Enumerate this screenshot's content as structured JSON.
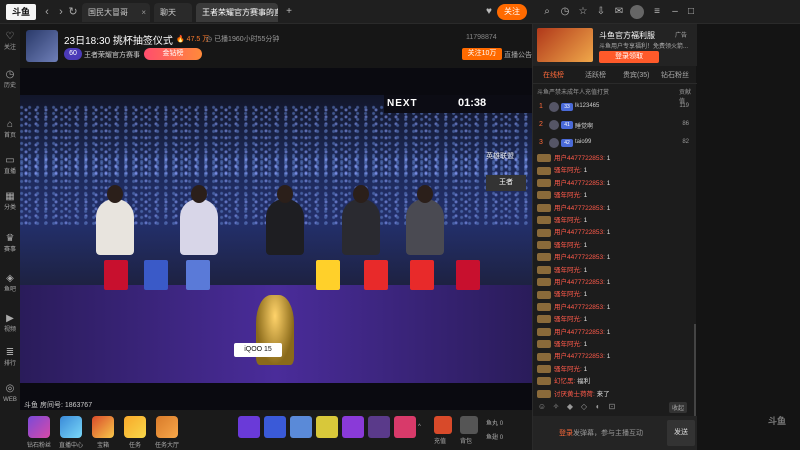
{
  "browser": {
    "logo": "斗鱼",
    "tabs": [
      {
        "label": "国民大冒哥"
      },
      {
        "label": "聊天"
      },
      {
        "label": "王者荣耀官方赛事的直播间 @..."
      }
    ],
    "follow_label": "关注"
  },
  "sidebar": {
    "items": [
      "关注",
      "历史",
      "首页",
      "直播",
      "分类",
      "赛事",
      "鱼吧",
      "视频",
      "排行",
      "WEB"
    ]
  },
  "room": {
    "title": "23日18:30 挑杯抽签仪式",
    "hot": "47.5 万",
    "live_time": "已播1960小时55分钟",
    "anchor": "王者荣耀官方赛事",
    "fan_badge": "金钻榜",
    "level": "60",
    "room_id_top": "11798874",
    "follow_count": "关注10万",
    "notice_label": "直播公告",
    "room_num_label": "斗鱼 房间号: 1863767"
  },
  "video": {
    "next_label": "NEXT",
    "timer": "01:38",
    "banner": "王者",
    "cam_logo": "英雄联盟",
    "sponsor": "iQOO 15"
  },
  "giftbar": {
    "labels": [
      "钻石粉丝",
      "直播中心",
      "宝箱",
      "任务",
      "任务大厅"
    ],
    "right_labels": [
      "充值",
      "背包"
    ],
    "counts": [
      "0",
      "0"
    ],
    "count_labels": [
      "鱼丸",
      "鱼翅"
    ]
  },
  "ad": {
    "title": "斗鱼官方福利服",
    "desc": "斗鱼用户专享福利！免费领火箭...",
    "button": "登录领取",
    "tag": "广告"
  },
  "panel": {
    "tabs": [
      "在线榜",
      "活跃榜",
      "贵宾(35)",
      "钻石粉丝"
    ],
    "rank_header": "斗鱼严禁未成年人充值打赏",
    "rank_col": "贡献值",
    "ranks": [
      {
        "no": "1",
        "badge": "33",
        "name": "lk123465",
        "score": "119"
      },
      {
        "no": "2",
        "badge": "41",
        "name": "睡觉啊",
        "score": "86"
      },
      {
        "no": "3",
        "badge": "42",
        "name": "taio99",
        "score": "82"
      }
    ],
    "chat": [
      {
        "user": "用户4477722853:",
        "text": "1"
      },
      {
        "user": "骚年阿光:",
        "text": "1"
      },
      {
        "user": "用户4477722853:",
        "text": "1"
      },
      {
        "user": "骚年阿光:",
        "text": "1"
      },
      {
        "user": "用户4477722853:",
        "text": "1"
      },
      {
        "user": "骚年阿光:",
        "text": "1"
      },
      {
        "user": "用户4477722853:",
        "text": "1"
      },
      {
        "user": "骚年阿光:",
        "text": "1"
      },
      {
        "user": "用户4477722853:",
        "text": "1"
      },
      {
        "user": "骚年阿光:",
        "text": "1"
      },
      {
        "user": "用户4477722853:",
        "text": "1"
      },
      {
        "user": "骚年阿光:",
        "text": "1"
      },
      {
        "user": "用户4477722853:",
        "text": "1"
      },
      {
        "user": "骚年阿光:",
        "text": "1"
      },
      {
        "user": "用户4477722853:",
        "text": "1"
      },
      {
        "user": "骚年阿光:",
        "text": "1"
      },
      {
        "user": "用户4477722853:",
        "text": "1"
      },
      {
        "user": "骚年阿光:",
        "text": "1"
      },
      {
        "user": "幻忆黑:",
        "text": "福利"
      },
      {
        "user": "讨厌黄士荷荷:",
        "text": "来了"
      }
    ],
    "input_hint_pre": "登录",
    "input_hint_post": "发弹幕，参与主播互动",
    "send": "发送",
    "fold": "收起"
  },
  "watermark": "斗鱼"
}
